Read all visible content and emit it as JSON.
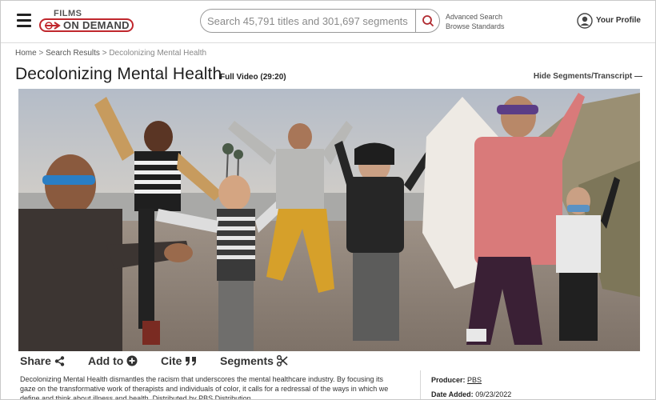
{
  "header": {
    "logo_top": "FILMS",
    "logo_bottom": "ON DEMAND",
    "search_placeholder": "Search 45,791 titles and 301,697 segments",
    "advanced_search": "Advanced Search",
    "browse_standards": "Browse Standards",
    "profile_label": "Your Profile"
  },
  "breadcrumb": {
    "home": "Home",
    "sep1": ">",
    "search_results": "Search Results",
    "sep2": ">",
    "current": "Decolonizing Mental Health"
  },
  "video": {
    "title": "Decolonizing Mental Health",
    "duration": "Full Video (29:20)",
    "hide_segments": "Hide Segments/Transcript —"
  },
  "actions": {
    "share": "Share",
    "add_to": "Add to",
    "cite": "Cite",
    "segments": "Segments"
  },
  "description": "Decolonizing Mental Health dismantles the racism that underscores the mental healthcare industry. By focusing its gaze on the transformative work of therapists and individuals of color, it calls for a redressal of the ways in which we define and think about illness and health. Distributed by PBS Distribution.",
  "meta": {
    "producer_label": "Producer:",
    "producer_value": "PBS",
    "date_label": "Date Added:",
    "date_value": "09/23/2022"
  },
  "colors": {
    "brand_red": "#c0272d",
    "search_icon": "#b02a30"
  }
}
